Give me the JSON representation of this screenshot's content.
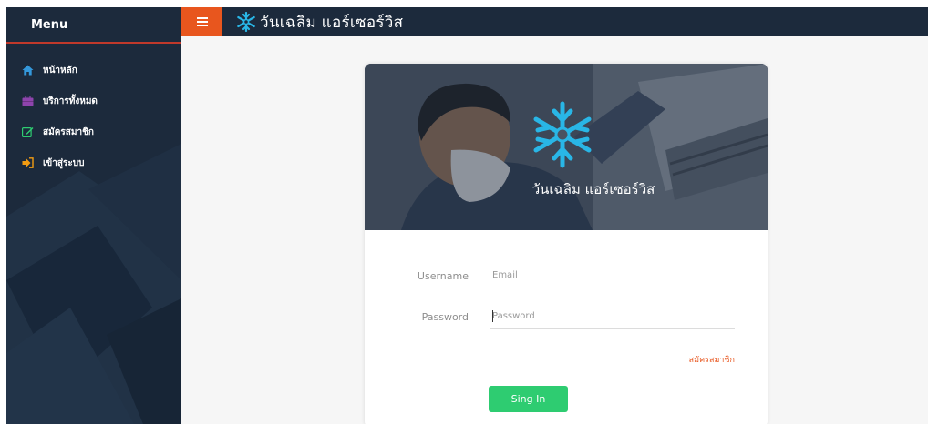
{
  "sidebar": {
    "title": "Menu",
    "items": [
      {
        "label": "หน้าหลัก",
        "icon": "home-icon",
        "color": "#3498db"
      },
      {
        "label": "บริการทั้งหมด",
        "icon": "briefcase-icon",
        "color": "#8e44ad"
      },
      {
        "label": "สมัครสมาชิก",
        "icon": "edit-icon",
        "color": "#2ecc71"
      },
      {
        "label": "เข้าสู่ระบบ",
        "icon": "sign-in-icon",
        "color": "#f39c12"
      }
    ]
  },
  "topbar": {
    "menu_icon": "hamburger-icon",
    "brand_logo": "snowflake-logo-icon",
    "brand_name": "วันเฉลิม แอร์เซอร์วิส"
  },
  "card": {
    "hero_title": "วันเฉลิม แอร์เซอร์วิส",
    "username_label": "Username",
    "username_placeholder": "Email",
    "password_label": "Password",
    "password_placeholder": "Password",
    "register_link": "สมัครสมาชิก",
    "signin_button": "Sing In"
  },
  "colors": {
    "sidebar_bg": "#1c2a3c",
    "accent_orange": "#e8561e",
    "button_green": "#2ecc71",
    "logo_blue": "#29b6e6"
  }
}
